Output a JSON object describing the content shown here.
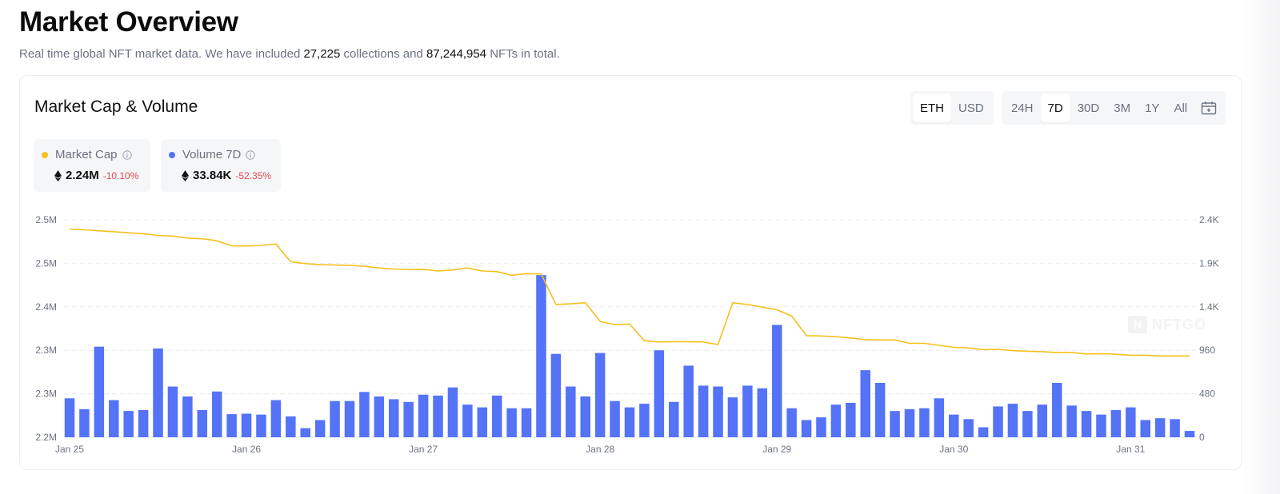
{
  "header": {
    "title": "Market Overview",
    "subtitle_pre": "Real time global NFT market data. We have included",
    "collections": "27,225",
    "subtitle_mid": "collections and",
    "nfts": "87,244,954",
    "subtitle_post": "NFTs in total."
  },
  "card": {
    "title": "Market Cap & Volume",
    "currency_options": [
      "ETH",
      "USD"
    ],
    "currency_selected": "ETH",
    "range_options": [
      "24H",
      "7D",
      "30D",
      "3M",
      "1Y",
      "All"
    ],
    "range_selected": "7D",
    "calendar_icon": "calendar-icon"
  },
  "legend": {
    "market_cap": {
      "label": "Market Cap",
      "value": "2.24M",
      "change": "-10.10%",
      "color": "#f5c01f"
    },
    "volume": {
      "label": "Volume 7D",
      "value": "33.84K",
      "change": "-52.35%",
      "color": "#5473f7"
    }
  },
  "watermark": "NFTGO",
  "colors": {
    "market_cap_line": "#f5c01f",
    "volume_bar": "#5473f7",
    "negative": "#e5484d",
    "grid": "#ececec"
  },
  "chart_data": {
    "type": "bar",
    "x_tick_labels": [
      "Jan 25",
      "Jan 26",
      "Jan 27",
      "Jan 28",
      "Jan 29",
      "Jan 30",
      "Jan 31"
    ],
    "y_left_tick_labels": [
      "2.2M",
      "2.3M",
      "2.3M",
      "2.4M",
      "2.5M",
      "2.5M"
    ],
    "y_right_tick_labels": [
      "0",
      "480",
      "960",
      "1.4K",
      "1.9K",
      "2.4K"
    ],
    "y_right_range": [
      0,
      2400
    ],
    "grid": true,
    "series": [
      {
        "name": "Volume 7D",
        "type": "bar",
        "axis": "right",
        "values": [
          430,
          310,
          1000,
          410,
          290,
          300,
          980,
          560,
          450,
          300,
          505,
          255,
          260,
          250,
          410,
          230,
          100,
          190,
          400,
          400,
          500,
          450,
          420,
          390,
          470,
          460,
          550,
          360,
          330,
          460,
          320,
          320,
          1790,
          920,
          560,
          450,
          930,
          400,
          330,
          370,
          960,
          390,
          790,
          570,
          560,
          440,
          570,
          540,
          1240,
          320,
          190,
          220,
          360,
          380,
          740,
          600,
          290,
          310,
          320,
          430,
          250,
          200,
          110,
          340,
          370,
          290,
          360,
          600,
          350,
          290,
          250,
          300,
          330,
          190,
          210,
          200,
          70
        ]
      },
      {
        "name": "Market Cap",
        "type": "line",
        "axis": "left",
        "values": [
          2.5135,
          2.5125,
          2.511,
          2.5095,
          2.508,
          2.5065,
          2.504,
          2.503,
          2.5,
          2.499,
          2.496,
          2.4885,
          2.488,
          2.489,
          2.491,
          2.4645,
          2.4615,
          2.46,
          2.4595,
          2.459,
          2.4575,
          2.455,
          2.4535,
          2.4525,
          2.453,
          2.4505,
          2.452,
          2.455,
          2.4505,
          2.4495,
          2.444,
          2.4465,
          2.446,
          2.4,
          2.401,
          2.4025,
          2.3745,
          2.3695,
          2.3705,
          2.3455,
          2.3435,
          2.344,
          2.344,
          2.3435,
          2.3395,
          2.4025,
          2.4,
          2.396,
          2.392,
          2.3825,
          2.353,
          2.3525,
          2.3515,
          2.3495,
          2.347,
          2.3465,
          2.3465,
          2.3415,
          2.3415,
          2.3385,
          2.3355,
          2.3345,
          2.332,
          2.3325,
          2.3305,
          2.3295,
          2.329,
          2.3275,
          2.3275,
          2.3255,
          2.326,
          2.325,
          2.3235,
          2.3235,
          2.3225,
          2.3225,
          2.3225
        ]
      }
    ]
  }
}
